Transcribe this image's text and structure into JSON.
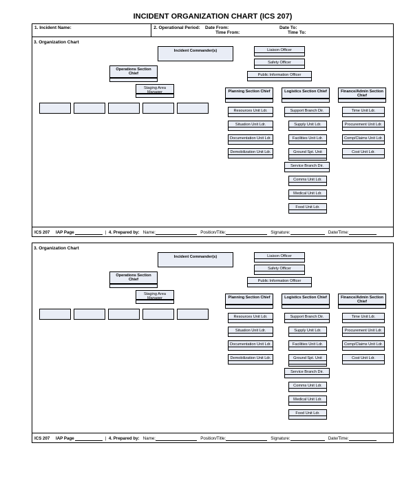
{
  "title": "INCIDENT ORGANIZATION CHART (ICS 207)",
  "header": {
    "incident_name_label": "1. Incident Name:",
    "op_period_label": "2. Operational Period:",
    "date_from": "Date From:",
    "date_to": "Date To:",
    "time_from": "Time From:",
    "time_to": "Time To:"
  },
  "section3_label": "3. Organization Chart",
  "footer": {
    "ics": "ICS 207",
    "iap": "IAP Page",
    "prepared_by": "4. Prepared by:",
    "name": "Name:",
    "position": "Position/Title:",
    "signature": "Signature:",
    "datetime": "Date/Time:"
  },
  "boxes": {
    "incident_commander": "Incident Commander(s)",
    "liaison": "Liaison Officer",
    "safety": "Safety Officer",
    "pio": "Public Information Officer",
    "ops_chief": "Operations Section Chief",
    "staging": "Staging Area Manager",
    "planning_chief": "Planning Section Chief",
    "logistics_chief": "Logistics Section Chief",
    "finance_chief": "Finance/Admin Section Chief",
    "resources": "Resources Unit Ldr.",
    "situation": "Situation Unit Ldr.",
    "documentation": "Documentation Unit Ldr.",
    "demob": "Demobilization Unit Ldr.",
    "support_branch": "Support Branch Dir.",
    "supply": "Supply Unit Ldr.",
    "facilities": "Facilities Unit Ldr.",
    "ground": "Ground Spt. Unit Ldr.",
    "service_branch": "Service Branch Dir.",
    "comms": "Comms Unit Ldr.",
    "medical": "Medical Unit Ldr.",
    "food": "Food Unit Ldr.",
    "time": "Time Unit Ldr.",
    "procurement": "Procurement Unit Ldr.",
    "comp": "Comp/Claims Unit Ldr.",
    "cost": "Cost Unit Ldr."
  }
}
